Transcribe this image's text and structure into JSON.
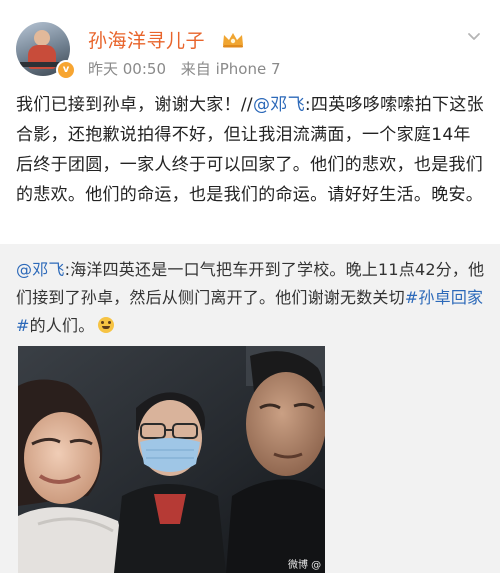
{
  "post": {
    "author": "孙海洋寻儿子",
    "time": "昨天 00:50",
    "source_label": "来自",
    "source_device": "iPhone 7",
    "text_before_mention": "我们已接到孙卓，谢谢大家！//",
    "mention": "@邓飞",
    "text_after_mention": ":四英哆哆嗦嗦拍下这张合影，还抱歉说拍得不好，但让我泪流满面，一个家庭14年后终于团圆，一家人终于可以回家了。他们的悲欢，也是我们的悲欢。他们的命运，也是我们的命运。请好好生活。晚安。"
  },
  "repost": {
    "author_mention": "@邓飞",
    "text_before_hashtag": ":海洋四英还是一口气把车开到了学校。晚上11点42分，他们接到了孙卓，然后从侧门离开了。他们谢谢无数关切",
    "hashtag": "#孙卓回家#",
    "text_after_hashtag": "的人们。",
    "emoji": "grin-emoji"
  },
  "photo": {
    "watermark": "微博 @邓飞"
  },
  "icons": {
    "verified_badge": "v-badge-icon",
    "member_crown": "crown-icon",
    "more": "chevron-down-icon"
  },
  "colors": {
    "username": "#e8642b",
    "link": "#2c69b9",
    "repost_background": "#f2f2f2",
    "verified_badge": "#f7a531"
  }
}
